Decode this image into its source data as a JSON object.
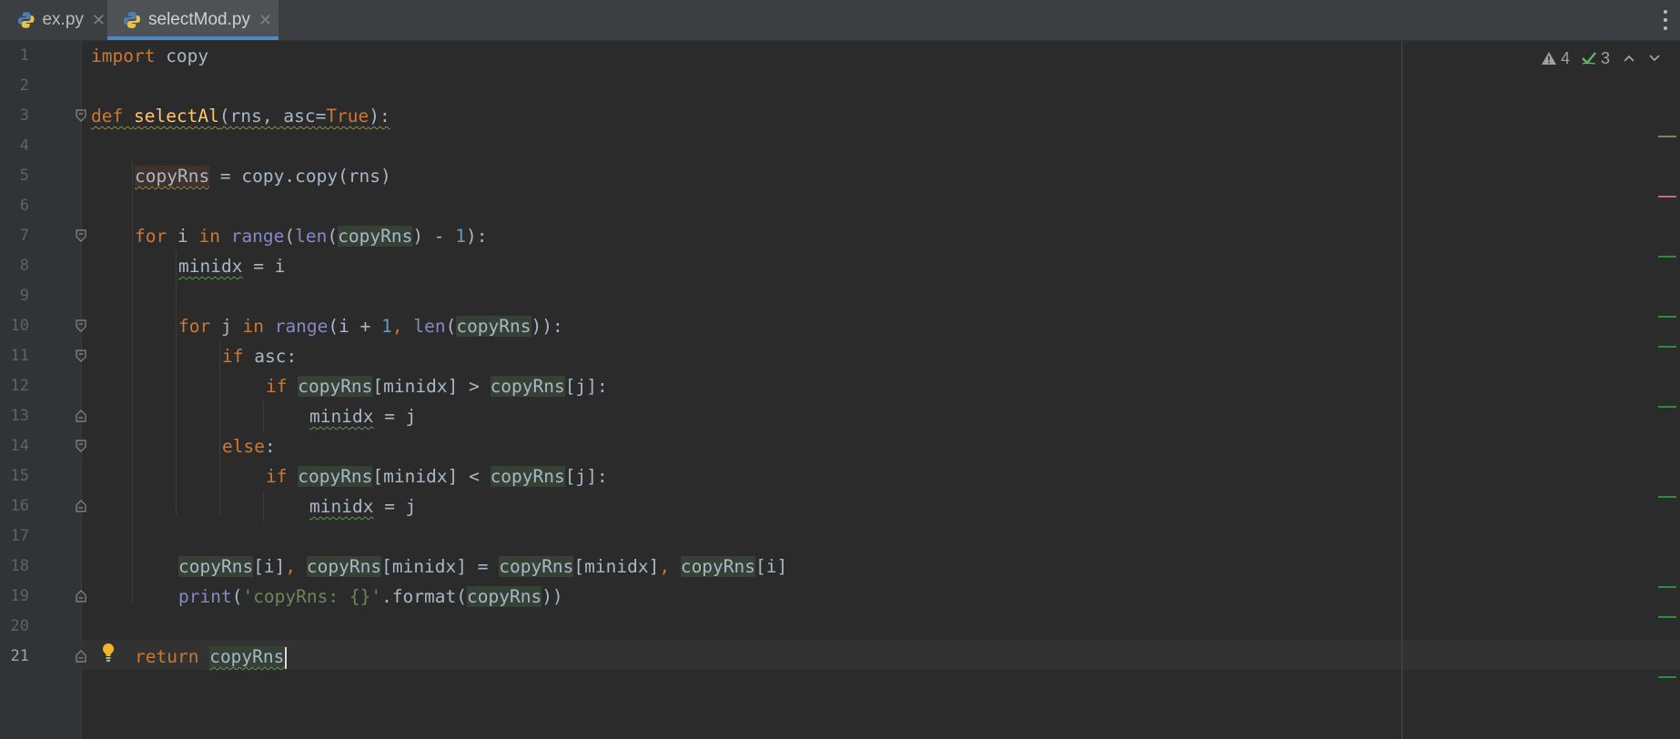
{
  "tabs": [
    {
      "label": "ex.py",
      "active": false,
      "icon": "python-file-icon"
    },
    {
      "label": "selectMod.py",
      "active": true,
      "icon": "python-file-icon"
    }
  ],
  "inspection": {
    "warnings": "4",
    "weak_warnings": "3"
  },
  "line_numbers": [
    "1",
    "2",
    "3",
    "4",
    "5",
    "6",
    "7",
    "8",
    "9",
    "10",
    "11",
    "12",
    "13",
    "14",
    "15",
    "16",
    "17",
    "18",
    "19",
    "20",
    "21"
  ],
  "current_line": "21",
  "code": {
    "l1_import": "import",
    "l1_mod": " copy",
    "l3_def": "def",
    "l3_name": "selectAl",
    "l3_args_a": "(rns, asc=",
    "l3_true": "True",
    "l3_args_b": "):",
    "l5_var": "copyRns",
    "l5_rest": " = copy.copy(rns)",
    "l7_for": "for",
    "l7_i": " i ",
    "l7_in": "in",
    "l7_range": "range",
    "l7_p1": "(",
    "l7_len": "len",
    "l7_p2": "(",
    "l7_var": "copyRns",
    "l7_p3": ") - ",
    "l7_one": "1",
    "l7_p4": "):",
    "l8_var": "minidx",
    "l8_rest": " = i",
    "l10_for": "for",
    "l10_j": " j ",
    "l10_in": "in",
    "l10_range": "range",
    "l10_p1": "(i + ",
    "l10_one": "1",
    "l10_comma": ", ",
    "l10_len": "len",
    "l10_p2": "(",
    "l10_var": "copyRns",
    "l10_p3": ")):",
    "l11_if": "if",
    "l11_rest": " asc:",
    "l12_if": "if",
    "l12_v1": "copyRns",
    "l12_m": "[minidx] > ",
    "l12_v2": "copyRns",
    "l12_e": "[j]:",
    "l13_var": "minidx",
    "l13_rest": " = j",
    "l14_else": "else",
    "l14_colon": ":",
    "l15_if": "if",
    "l15_v1": "copyRns",
    "l15_m": "[minidx] < ",
    "l15_v2": "copyRns",
    "l15_e": "[j]:",
    "l16_var": "minidx",
    "l16_rest": " = j",
    "l18_v1": "copyRns",
    "l18_a": "[i]",
    "l18_c1": ", ",
    "l18_v2": "copyRns",
    "l18_b": "[minidx] = ",
    "l18_v3": "copyRns",
    "l18_c": "[minidx]",
    "l18_c2": ", ",
    "l18_v4": "copyRns",
    "l18_d": "[i]",
    "l19_print": "print",
    "l19_p1": "(",
    "l19_str": "'copyRns: {}'",
    "l19_fmt": ".format(",
    "l19_var": "copyRns",
    "l19_p2": "))",
    "l21_return": "return",
    "l21_var": "copyRns"
  },
  "colors": {
    "background": "#2b2b2b",
    "keyword": "#cc7832",
    "function": "#ffc66d",
    "builtin": "#8888c6",
    "number": "#6897bb",
    "string": "#6a8759",
    "text": "#a9b7c6"
  }
}
